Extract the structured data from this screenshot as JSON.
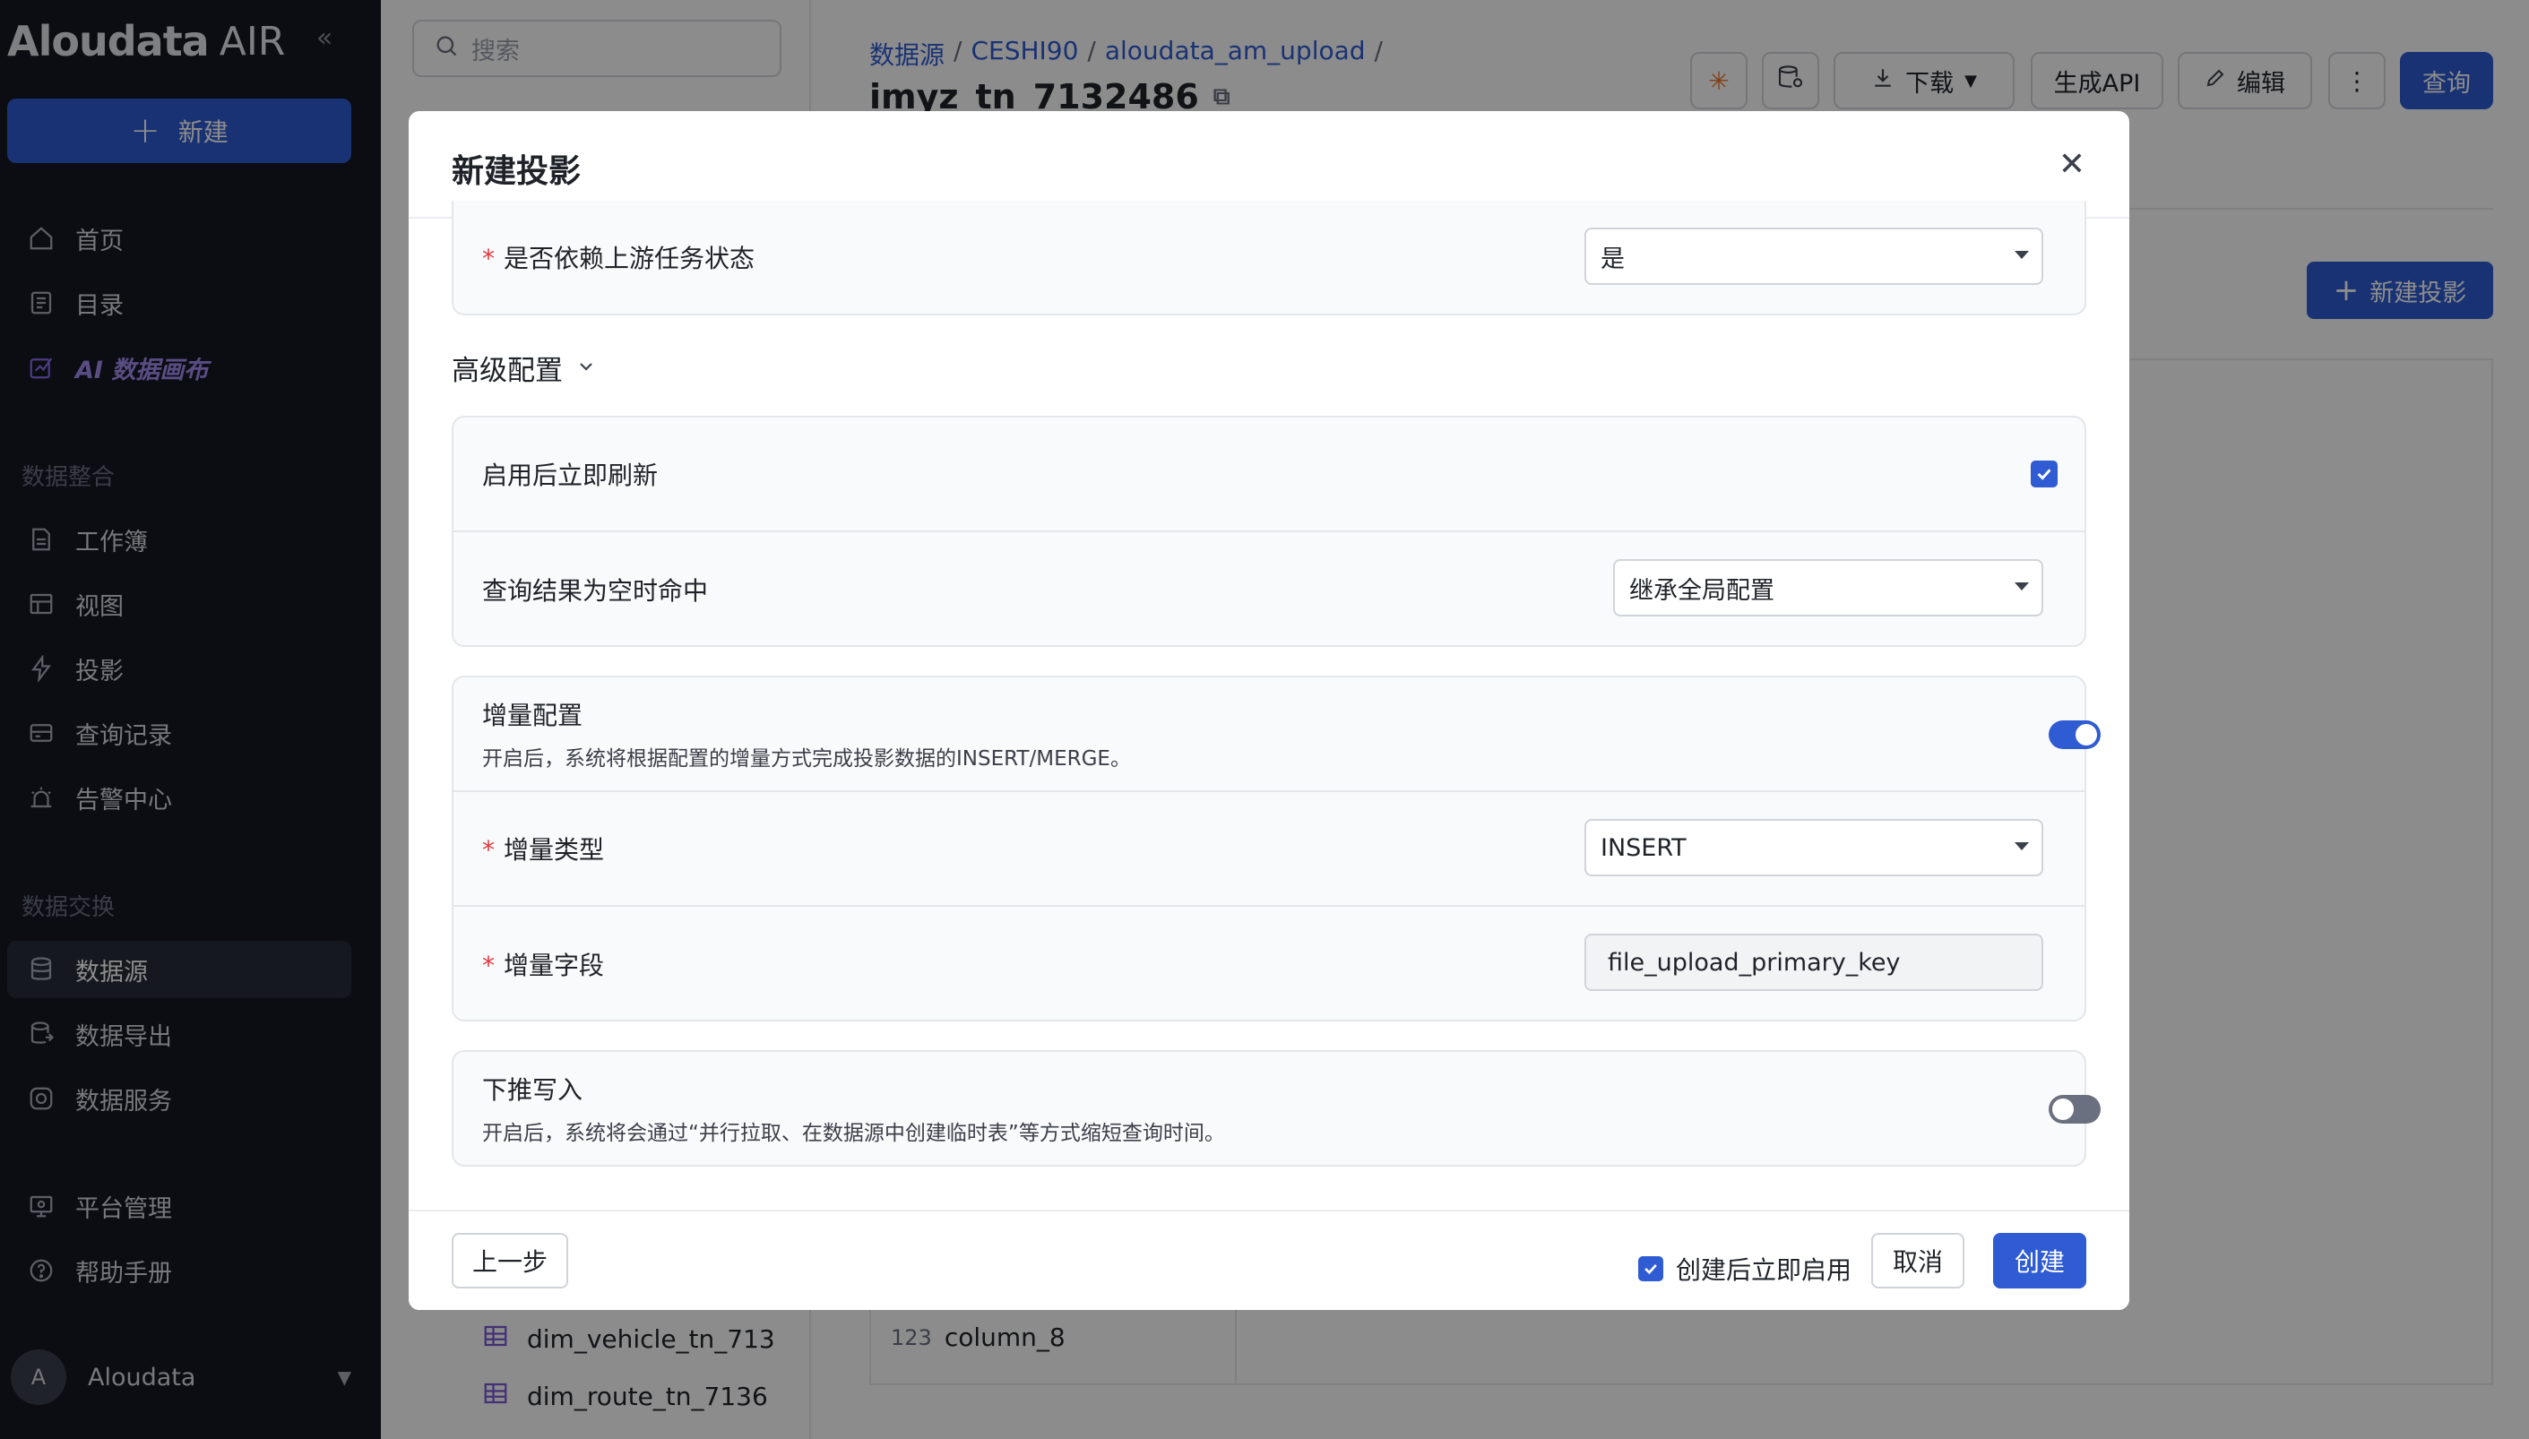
{
  "app": {
    "logo": "Aloudata",
    "logo_suffix": "AIR",
    "new_button": "新建"
  },
  "sidebar": {
    "nav_top": [
      {
        "label": "首页",
        "icon": "home-icon"
      },
      {
        "label": "目录",
        "icon": "catalog-icon"
      },
      {
        "label": "AI 数据画布",
        "icon": "ai-canvas-icon"
      }
    ],
    "section_integration": "数据整合",
    "nav_integration": [
      {
        "label": "工作簿",
        "icon": "workbook-icon"
      },
      {
        "label": "视图",
        "icon": "view-icon"
      },
      {
        "label": "投影",
        "icon": "projection-icon"
      },
      {
        "label": "查询记录",
        "icon": "query-log-icon"
      },
      {
        "label": "告警中心",
        "icon": "alert-icon"
      }
    ],
    "section_exchange": "数据交换",
    "nav_exchange": [
      {
        "label": "数据源",
        "icon": "datasource-icon",
        "active": true
      },
      {
        "label": "数据导出",
        "icon": "export-icon"
      },
      {
        "label": "数据服务",
        "icon": "service-icon"
      }
    ],
    "nav_bottom": [
      {
        "label": "平台管理",
        "icon": "platform-icon"
      },
      {
        "label": "帮助手册",
        "icon": "help-icon"
      }
    ],
    "user": {
      "initial": "A",
      "name": "Aloudata"
    }
  },
  "background": {
    "search_placeholder": "搜索",
    "tree_items": [
      "dim_vehicle_tn_713",
      "dim_route_tn_7136"
    ],
    "breadcrumb": [
      "数据源",
      "CESHI90",
      "aloudata_am_upload"
    ],
    "table_title": "imyz_tn_7132486",
    "toolbar": {
      "download": "下载",
      "gen_api": "生成API",
      "edit": "编辑",
      "query": "查询"
    },
    "new_projection": "新建投影",
    "column": {
      "type": "123",
      "name": "column_8"
    }
  },
  "modal": {
    "title": "新建投影",
    "depend_upstream": {
      "label": "是否依赖上游任务状态",
      "value": "是"
    },
    "advanced_title": "高级配置",
    "refresh_after_enable": {
      "label": "启用后立即刷新",
      "checked": true
    },
    "empty_hit": {
      "label": "查询结果为空时命中",
      "value": "继承全局配置"
    },
    "incremental": {
      "label": "增量配置",
      "desc": "开启后，系统将根据配置的增量方式完成投影数据的INSERT/MERGE。",
      "enabled": true,
      "type_label": "增量类型",
      "type_value": "INSERT",
      "field_label": "增量字段",
      "field_value": "file_upload_primary_key"
    },
    "pushdown": {
      "label": "下推写入",
      "desc": "开启后，系统将会通过“并行拉取、在数据源中创建临时表”等方式缩短查询时间。",
      "enabled": false
    },
    "footer": {
      "prev": "上一步",
      "enable_after_create": "创建后立即启用",
      "cancel": "取消",
      "create": "创建"
    }
  }
}
